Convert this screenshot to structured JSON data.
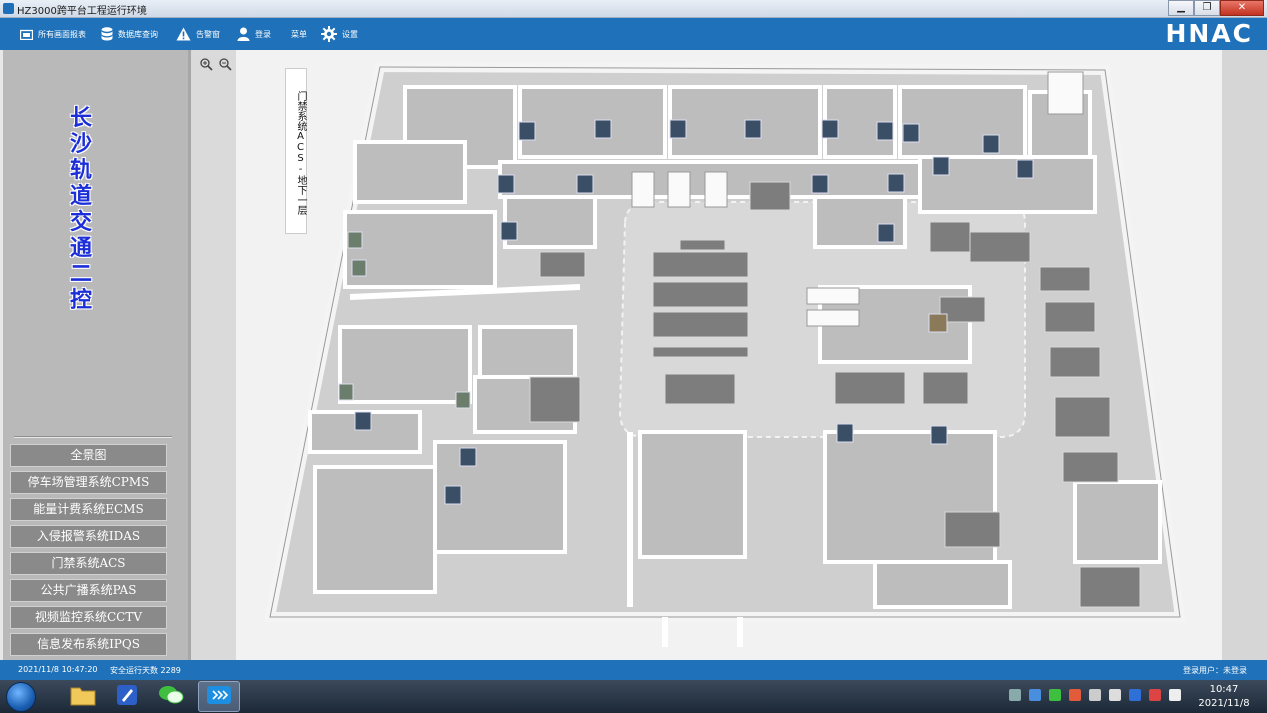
{
  "window": {
    "title": "HZ3000跨平台工程运行环境",
    "minimize": "▁",
    "maximize": "❐",
    "close": "✕"
  },
  "toolbar": {
    "items": [
      {
        "label": "所有画面报表",
        "icon": "screen-report-icon"
      },
      {
        "label": "数据库查询",
        "icon": "database-icon"
      },
      {
        "label": "告警窗",
        "icon": "warning-icon"
      },
      {
        "label": "登录",
        "icon": "user-icon"
      },
      {
        "label": "菜单",
        "icon": ""
      },
      {
        "label": "设置",
        "icon": "gear-icon"
      }
    ],
    "logo": "HNAC"
  },
  "sidebar": {
    "title": "长沙轨道交通二控",
    "menu": [
      {
        "label": "全景图"
      },
      {
        "label": "停车场管理系统CPMS"
      },
      {
        "label": "能量计费系统ECMS"
      },
      {
        "label": "入侵报警系统IDAS"
      },
      {
        "label": "门禁系统ACS"
      },
      {
        "label": "公共广播系统PAS"
      },
      {
        "label": "视频监控系统CCTV"
      },
      {
        "label": "信息发布系统IPQS"
      }
    ]
  },
  "map": {
    "label": "门禁系统ACS-地下一层",
    "zoom_in_icon": "zoom-in-icon",
    "zoom_out_icon": "zoom-out-icon",
    "zoom_reset_icon": "zoom-reset-icon"
  },
  "status": {
    "datetime": "2021/11/8 10:47:20",
    "safe_days": "安全运行天数 2289",
    "login_user": "登录用户：未登录"
  },
  "taskbar": {
    "time": "10:47",
    "date": "2021/11/8"
  },
  "colors": {
    "toolbar_blue": "#1f72b9",
    "sidebar_title": "#1b2ed8",
    "menu_button": "#8a8a8a"
  }
}
